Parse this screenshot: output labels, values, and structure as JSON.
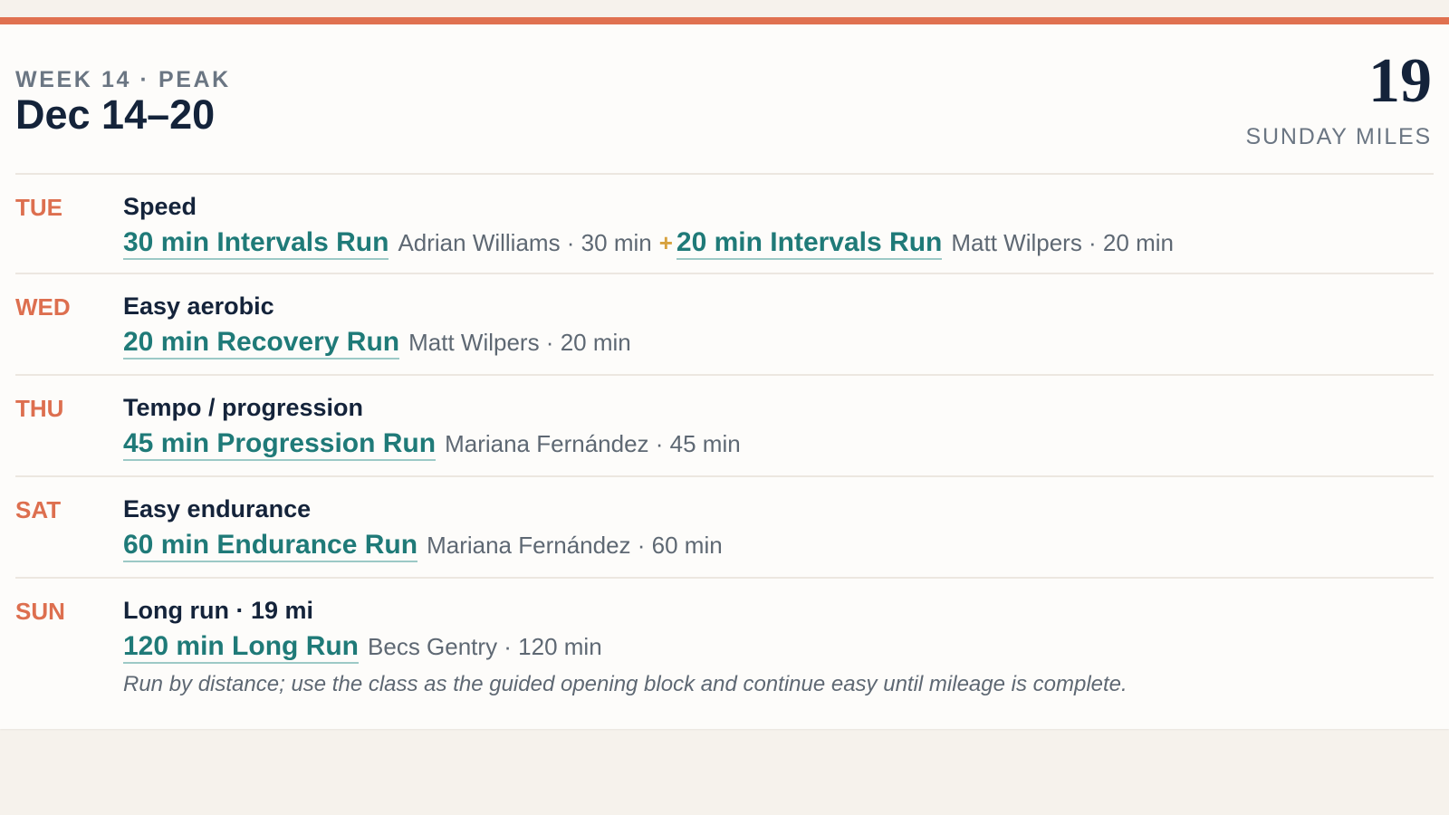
{
  "colors": {
    "accent": "#e07150",
    "day_label": "#dd6f4f",
    "link": "#1f7a78",
    "plus": "#d7a23f",
    "heading": "#14233a",
    "muted": "#6b7683"
  },
  "header": {
    "eyebrow": "WEEK 14 · PEAK",
    "title": "Dec 14–20",
    "miles_value": "19",
    "miles_label": "SUNDAY MILES"
  },
  "days": [
    {
      "day": "TUE",
      "focus": "Speed",
      "classes": [
        {
          "title": "30 min Intervals Run",
          "meta": "Adrian Williams · 30 min"
        },
        {
          "title": "20 min Intervals Run",
          "meta": "Matt Wilpers · 20 min"
        }
      ],
      "joiner": "+"
    },
    {
      "day": "WED",
      "focus": "Easy aerobic",
      "classes": [
        {
          "title": "20 min Recovery Run",
          "meta": "Matt Wilpers · 20 min"
        }
      ]
    },
    {
      "day": "THU",
      "focus": "Tempo / progression",
      "classes": [
        {
          "title": "45 min Progression Run",
          "meta": "Mariana Fernández · 45 min"
        }
      ]
    },
    {
      "day": "SAT",
      "focus": "Easy endurance",
      "classes": [
        {
          "title": "60 min Endurance Run",
          "meta": "Mariana Fernández · 60 min"
        }
      ]
    },
    {
      "day": "SUN",
      "focus": "Long run · 19 mi",
      "classes": [
        {
          "title": "120 min Long Run",
          "meta": "Becs Gentry · 120 min"
        }
      ],
      "note": "Run by distance; use the class as the guided opening block and continue easy until mileage is complete."
    }
  ]
}
